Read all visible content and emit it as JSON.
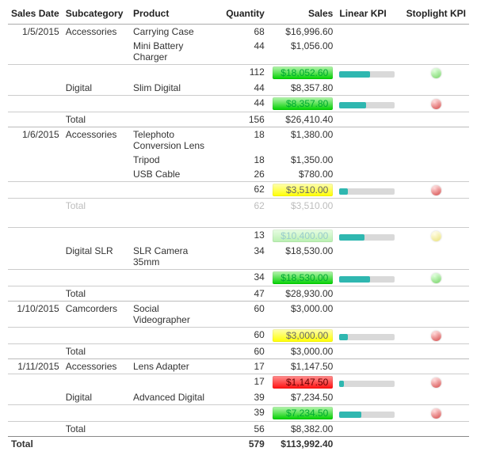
{
  "columns": {
    "date": "Sales Date",
    "sub": "Subcategory",
    "prod": "Product",
    "qty": "Quantity",
    "sal": "Sales",
    "lin": "Linear KPI",
    "stop": "Stoplight KPI"
  },
  "total_label": "Total",
  "grand_total": {
    "qty": "579",
    "sal": "$113,992.40"
  },
  "d0": {
    "date": "1/5/2015",
    "sub0": "Accessories",
    "p00": {
      "name": "Carrying Case",
      "qty": "68",
      "sal": "$16,996.60"
    },
    "p01": {
      "name": "Mini Battery Charger",
      "qty": "44",
      "sal": "$1,056.00"
    },
    "st0": {
      "qty": "112",
      "sal": "$18,052.60",
      "pill": "green",
      "bar": 55,
      "dot": "g"
    },
    "sub1": "Digital",
    "p10": {
      "name": "Slim Digital",
      "qty": "44",
      "sal": "$8,357.80"
    },
    "st1": {
      "qty": "44",
      "sal": "$8,357.80",
      "pill": "green",
      "bar": 48,
      "dot": "r"
    },
    "tot": {
      "qty": "156",
      "sal": "$26,410.40"
    }
  },
  "d1": {
    "date": "1/6/2015",
    "sub0": "Accessories",
    "p00": {
      "name": "Telephoto Conversion Lens",
      "qty": "18",
      "sal": "$1,380.00"
    },
    "p01": {
      "name": "Tripod",
      "qty": "18",
      "sal": "$1,350.00"
    },
    "p02": {
      "name": "USB Cable",
      "qty": "26",
      "sal": "$780.00"
    },
    "st0": {
      "qty": "62",
      "sal": "$3,510.00",
      "pill": "yellow",
      "bar": 15,
      "dot": "r"
    },
    "totA": {
      "qty": "62",
      "sal": "$3,510.00"
    },
    "stX": {
      "qty": "13",
      "sal": "$10,400.00",
      "pill": "fgrn",
      "bar": 45,
      "dot": "y"
    },
    "sub1": "Digital SLR",
    "p10": {
      "name": "SLR Camera 35mm",
      "qty": "34",
      "sal": "$18,530.00"
    },
    "st1": {
      "qty": "34",
      "sal": "$18,530.00",
      "pill": "green",
      "bar": 55,
      "dot": "g"
    },
    "tot": {
      "qty": "47",
      "sal": "$28,930.00"
    }
  },
  "d2": {
    "date": "1/10/2015",
    "sub0": "Camcorders",
    "p00": {
      "name": "Social Videographer",
      "qty": "60",
      "sal": "$3,000.00"
    },
    "st0": {
      "qty": "60",
      "sal": "$3,000.00",
      "pill": "yellow",
      "bar": 15,
      "dot": "r"
    },
    "tot": {
      "qty": "60",
      "sal": "$3,000.00"
    }
  },
  "d3": {
    "date": "1/11/2015",
    "sub0": "Accessories",
    "p00": {
      "name": "Lens Adapter",
      "qty": "17",
      "sal": "$1,147.50"
    },
    "st0": {
      "qty": "17",
      "sal": "$1,147.50",
      "pill": "red",
      "bar": 8,
      "dot": "r"
    },
    "sub1": "Digital",
    "p10": {
      "name": "Advanced Digital",
      "qty": "39",
      "sal": "$7,234.50"
    },
    "st1": {
      "qty": "39",
      "sal": "$7,234.50",
      "pill": "green",
      "bar": 40,
      "dot": "r"
    },
    "tot": {
      "qty": "56",
      "sal": "$8,382.00"
    }
  }
}
